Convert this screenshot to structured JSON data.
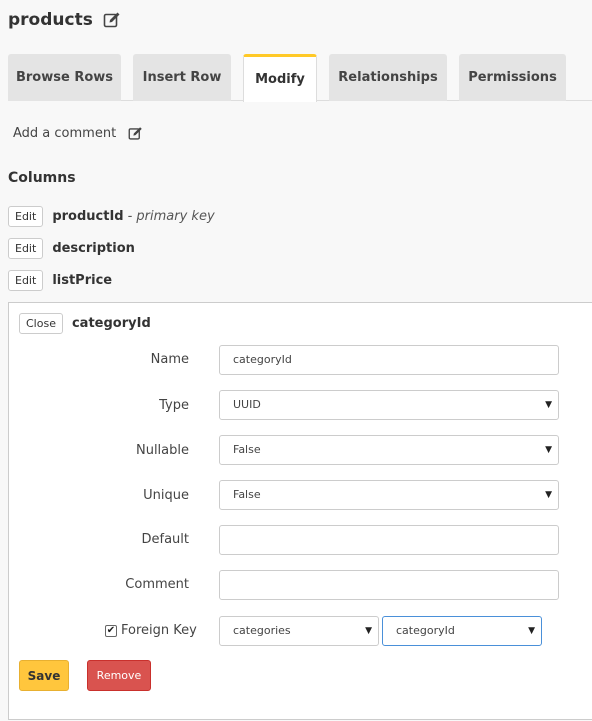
{
  "table": {
    "title": "products"
  },
  "tabs": [
    {
      "label": "Browse Rows"
    },
    {
      "label": "Insert Row"
    },
    {
      "label": "Modify"
    },
    {
      "label": "Relationships"
    },
    {
      "label": "Permissions"
    }
  ],
  "comment": {
    "label": "Add a comment"
  },
  "columns_section": {
    "title": "Columns"
  },
  "columns": [
    {
      "edit_label": "Edit",
      "name": "productId",
      "note": "- primary key"
    },
    {
      "edit_label": "Edit",
      "name": "description",
      "note": ""
    },
    {
      "edit_label": "Edit",
      "name": "listPrice",
      "note": ""
    }
  ],
  "editor": {
    "close_label": "Close",
    "column_name": "categoryId",
    "fields": {
      "name": {
        "label": "Name",
        "value": "categoryId"
      },
      "type": {
        "label": "Type",
        "value": "UUID"
      },
      "nullable": {
        "label": "Nullable",
        "value": "False"
      },
      "unique": {
        "label": "Unique",
        "value": "False"
      },
      "default": {
        "label": "Default",
        "value": ""
      },
      "comment": {
        "label": "Comment",
        "value": ""
      }
    },
    "foreign_key": {
      "label": "Foreign Key",
      "checked": true,
      "ref_table": "categories",
      "ref_column": "categoryId"
    },
    "save_label": "Save",
    "remove_label": "Remove"
  },
  "colors": {
    "active_tab_accent": "#ffc927",
    "save_button": "#ffc63d",
    "remove_button": "#d9534f",
    "focus_border": "#4a90d9"
  },
  "icons": [
    "edit-icon",
    "chevron-down-icon",
    "check-icon"
  ]
}
